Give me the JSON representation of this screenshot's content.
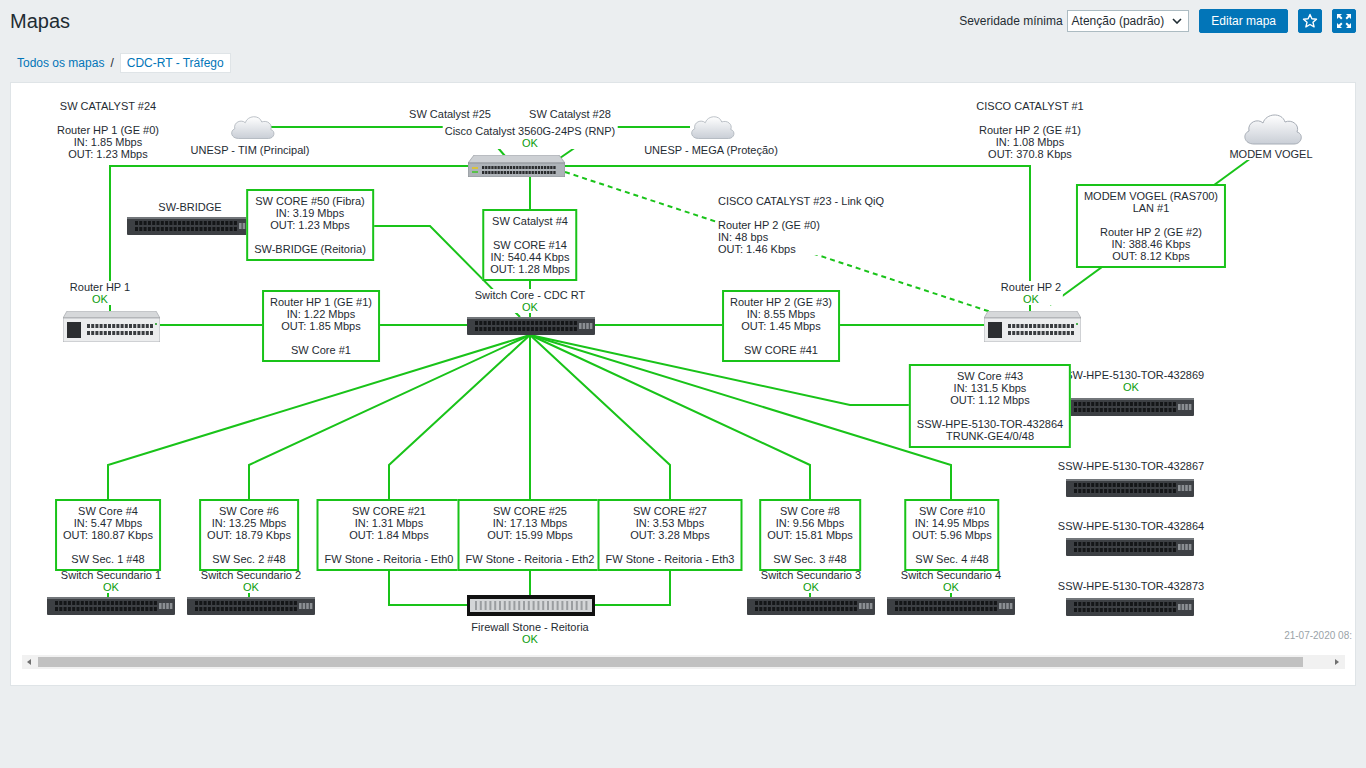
{
  "page": {
    "title": "Mapas"
  },
  "toolbar": {
    "severity_label": "Severidade mínima",
    "severity_value": "Atenção (padrão)",
    "edit_button": "Editar mapa",
    "favorite": false
  },
  "breadcrumb": {
    "separator": "/",
    "items": [
      {
        "label": "Todos os mapas",
        "selected": false
      },
      {
        "label": "CDC-RT - Tráfego",
        "selected": true
      }
    ]
  },
  "map": {
    "hosts": [
      {
        "name": "Cisco Catalyst 3560G-24PS (RNP)",
        "kind": "catalyst",
        "status": "OK"
      },
      {
        "name": "UNESP - TIM (Principal)",
        "kind": "cloud"
      },
      {
        "name": "UNESP - MEGA (Proteção)",
        "kind": "cloud"
      },
      {
        "name": "MODEM VOGEL",
        "kind": "cloud"
      },
      {
        "name": "SW-BRIDGE",
        "kind": "switch"
      },
      {
        "name": "Router HP 1",
        "kind": "router",
        "status": "OK"
      },
      {
        "name": "Switch Core - CDC RT",
        "kind": "switch",
        "status": "OK"
      },
      {
        "name": "Router HP 2",
        "kind": "router",
        "status": "OK"
      },
      {
        "name": "SSW-HPE-5130-TOR-432869",
        "kind": "switch",
        "status": "OK"
      },
      {
        "name": "SSW-HPE-5130-TOR-432867",
        "kind": "switch"
      },
      {
        "name": "SSW-HPE-5130-TOR-432864",
        "kind": "switch"
      },
      {
        "name": "SSW-HPE-5130-TOR-432873",
        "kind": "switch"
      },
      {
        "name": "Switch Secundario 1",
        "kind": "switch",
        "status": "OK"
      },
      {
        "name": "Switch Secundario 2",
        "kind": "switch",
        "status": "OK"
      },
      {
        "name": "Firewall Stone - Reitoria",
        "kind": "firewall",
        "status": "OK"
      },
      {
        "name": "Switch Secundario 3",
        "kind": "switch",
        "status": "OK"
      },
      {
        "name": "Switch Secundario 4",
        "kind": "switch",
        "status": "OK"
      }
    ],
    "links": [
      {
        "kind": "plain",
        "dashed": false,
        "label": [
          "SW CATALYST #24",
          "",
          "Router HP 1 (GE #0)",
          "IN: 1.85 Mbps",
          "OUT: 1.23 Mbps"
        ]
      },
      {
        "kind": "plain",
        "dashed": false,
        "label": [
          "CISCO CATALYST #1",
          "",
          "Router HP 2 (GE #1)",
          "IN: 1.08 Mbps",
          "OUT: 370.8 Kbps"
        ]
      },
      {
        "kind": "plain",
        "dashed": false,
        "label": [
          "SW Catalyst #25"
        ]
      },
      {
        "kind": "plain",
        "dashed": false,
        "label": [
          "SW Catalyst #28"
        ]
      },
      {
        "kind": "plain",
        "dashed": true,
        "label": [
          "CISCO CATALYST #23 - Link QiQ",
          "",
          "Router HP 2 (GE #0)",
          "IN: 48 bps",
          "OUT: 1.46 Kbps"
        ]
      },
      {
        "kind": "boxed",
        "dashed": false,
        "label": [
          "SW CORE #50 (Fibra)",
          "IN: 3.19 Mbps",
          "OUT: 1.23 Mbps",
          "",
          "SW-BRIDGE (Reitoria)"
        ]
      },
      {
        "kind": "boxed",
        "dashed": false,
        "label": [
          "SW Catalyst #4",
          "",
          "SW CORE #14",
          "IN: 540.44 Kbps",
          "OUT: 1.28 Mbps"
        ]
      },
      {
        "kind": "boxed",
        "dashed": false,
        "label": [
          "Router HP 1 (GE #1)",
          "IN: 1.22 Mbps",
          "OUT: 1.85 Mbps",
          "",
          "SW Core #1"
        ]
      },
      {
        "kind": "boxed",
        "dashed": false,
        "label": [
          "Router HP 2 (GE #3)",
          "IN: 8.55 Mbps",
          "OUT: 1.45 Mbps",
          "",
          "SW CORE #41"
        ]
      },
      {
        "kind": "boxed",
        "dashed": false,
        "label": [
          "MODEM VOGEL (RAS700)",
          "LAN #1",
          "",
          "Router HP 2 (GE #2)",
          "IN: 388.46 Kbps",
          "OUT: 8.12 Kbps"
        ]
      },
      {
        "kind": "boxed",
        "dashed": false,
        "label": [
          "SW Core #43",
          "IN: 131.5 Kbps",
          "OUT: 1.12 Mbps",
          "",
          "SSW-HPE-5130-TOR-432864",
          "TRUNK-GE4/0/48"
        ]
      },
      {
        "kind": "boxed",
        "dashed": false,
        "label": [
          "SW Core #4",
          "IN: 5.47 Mbps",
          "OUT: 180.87 Kbps",
          "",
          "SW Sec. 1 #48"
        ]
      },
      {
        "kind": "boxed",
        "dashed": false,
        "label": [
          "SW Core #6",
          "IN: 13.25 Mbps",
          "OUT: 18.79 Kbps",
          "",
          "SW Sec. 2 #48"
        ]
      },
      {
        "kind": "boxed",
        "dashed": false,
        "label": [
          "SW CORE #21",
          "IN: 1.31 Mbps",
          "OUT: 1.84 Mbps",
          "",
          "FW Stone - Reitoria - Eth0"
        ]
      },
      {
        "kind": "boxed",
        "dashed": false,
        "label": [
          "SW CORE #25",
          "IN: 17.13 Mbps",
          "OUT: 15.99 Mbps",
          "",
          "FW Stone - Reitoria - Eth2"
        ]
      },
      {
        "kind": "boxed",
        "dashed": false,
        "label": [
          "SW CORE #27",
          "IN: 3.53 Mbps",
          "OUT: 3.28 Mbps",
          "",
          "FW Stone - Reitoria - Eth3"
        ]
      },
      {
        "kind": "boxed",
        "dashed": false,
        "label": [
          "SW Core #8",
          "IN: 9.56 Mbps",
          "OUT: 15.81 Mbps",
          "",
          "SW Sec. 3 #48"
        ]
      },
      {
        "kind": "boxed",
        "dashed": false,
        "label": [
          "SW Core #10",
          "IN: 14.95 Mbps",
          "OUT: 5.96 Mbps",
          "",
          "SW Sec. 4 #48"
        ]
      }
    ],
    "timestamp": "21-07-2020 08:"
  },
  "scrollbar": {
    "level": 0.98
  }
}
